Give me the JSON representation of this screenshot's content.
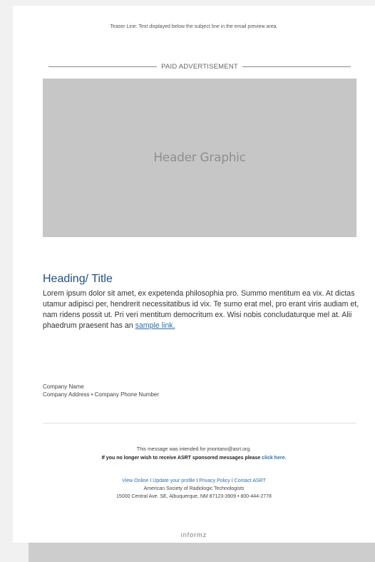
{
  "teaser": "Teaser Line: Text displayed below the subject line in the email preview area.",
  "ad_label": "PAID ADVERTISEMENT",
  "header_graphic_label": "Header Graphic",
  "heading": "Heading/ Title",
  "body_text": "Lorem ipsum dolor sit amet, ex expetenda philosophia pro. Summo mentitum ea vix. At dictas utamur adipisci per, hendrerit necessitatibus id vix. Te sumo erat mel, pro erant viris audiam et, nam ridens possit ut. Pri veri mentitum democritum ex. Wisi nobis concludaturque mel at. Alii phaedrum praesent has an",
  "sample_link": "sample link.",
  "company": {
    "name": "Company Name",
    "address_line": "Company Address • Company Phone Number"
  },
  "footer": {
    "intended_for": "This message was intended for jmontano@asrt.org.",
    "unsubscribe_text": "If you no longer wish to receive ASRT sponsored messages please",
    "unsubscribe_link": "click here.",
    "links": [
      "View Online",
      "Update your profile",
      "Privacy Policy",
      "Contact ASRT"
    ],
    "link_separator": "I",
    "org_name": "American Society of Radiologic Technologists",
    "org_address": "15000 Central Ave. SE, Albuquerque, NM 87123-3909 • 800-444-2778",
    "brand": "informz"
  },
  "colors": {
    "heading": "#1f4e8c",
    "link": "#2e6fae",
    "header_graphic_bg": "#c6c6c6",
    "page_bg": "#f1f1f1"
  }
}
